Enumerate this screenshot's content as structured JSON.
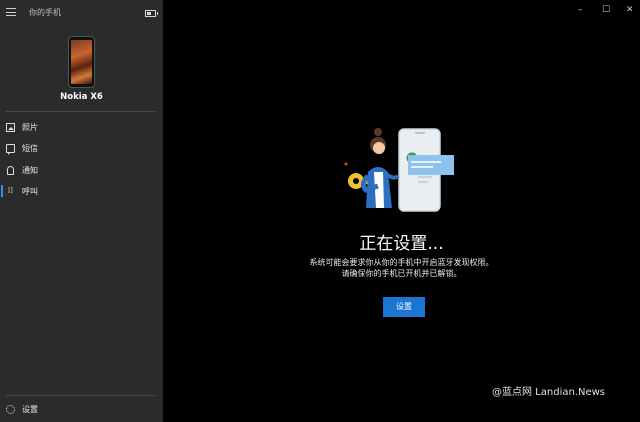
{
  "app": {
    "title": "你的手机"
  },
  "device": {
    "name": "Nokia X6"
  },
  "nav": {
    "items": [
      {
        "label": "照片",
        "icon": "photo-icon"
      },
      {
        "label": "短信",
        "icon": "message-icon"
      },
      {
        "label": "通知",
        "icon": "bell-icon"
      },
      {
        "label": "呼叫",
        "icon": "dialpad-icon",
        "active": true
      }
    ],
    "settings": {
      "label": "设置",
      "icon": "gear-icon"
    }
  },
  "window_controls": {
    "minimize": "–",
    "maximize": "☐",
    "close": "✕"
  },
  "main": {
    "title": "正在设置...",
    "description_line1": "系统可能会要求你从你的手机中开启蓝牙发现权限。",
    "description_line2": "请确保你的手机已开机并已解锁。",
    "button_label": "设置"
  },
  "watermark": {
    "text": "@蓝点网 Landian.News"
  },
  "colors": {
    "accent": "#1a76d2",
    "sidebar_bg": "#2b2b2b",
    "main_bg": "#000000"
  }
}
